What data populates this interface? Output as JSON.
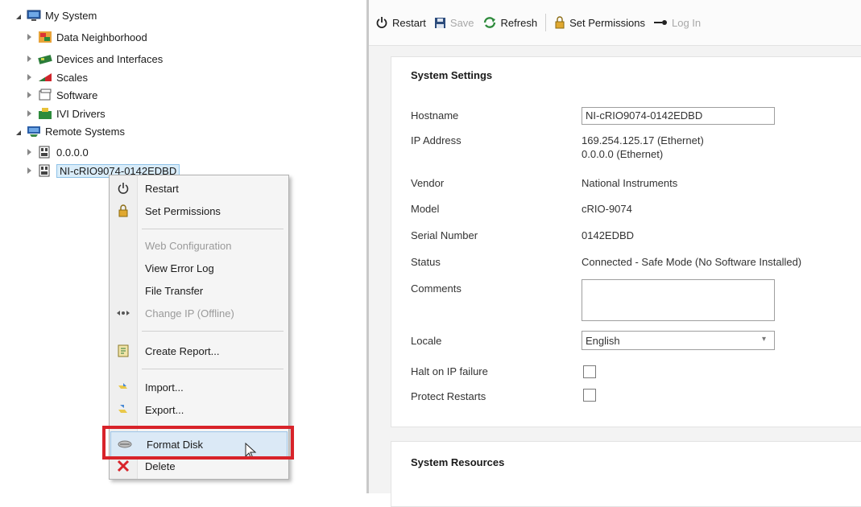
{
  "tree": {
    "my_system": "My System",
    "data_neighborhood": "Data Neighborhood",
    "devices": "Devices and Interfaces",
    "scales": "Scales",
    "software": "Software",
    "ivi": "IVI Drivers",
    "remote": "Remote Systems",
    "ip0": "0.0.0.0",
    "target": "NI-cRIO9074-0142EDBD"
  },
  "menu": {
    "restart": "Restart",
    "set_permissions": "Set Permissions",
    "web_config": "Web Configuration",
    "view_error_log": "View Error Log",
    "file_transfer": "File Transfer",
    "change_ip": "Change IP (Offline)",
    "create_report": "Create Report...",
    "import": "Import...",
    "export": "Export...",
    "format_disk": "Format Disk",
    "delete": "Delete"
  },
  "toolbar": {
    "restart": "Restart",
    "save": "Save",
    "refresh": "Refresh",
    "set_permissions": "Set Permissions",
    "login": "Log In"
  },
  "settings": {
    "title": "System Settings",
    "hostname_label": "Hostname",
    "hostname_value": "NI-cRIO9074-0142EDBD",
    "ip_label": "IP Address",
    "ip_value1": "169.254.125.17 (Ethernet)",
    "ip_value2": "0.0.0.0 (Ethernet)",
    "vendor_label": "Vendor",
    "vendor_value": "National Instruments",
    "model_label": "Model",
    "model_value": "cRIO-9074",
    "serial_label": "Serial Number",
    "serial_value": "0142EDBD",
    "status_label": "Status",
    "status_value": "Connected - Safe Mode (No Software Installed)",
    "comments_label": "Comments",
    "comments_value": "",
    "locale_label": "Locale",
    "locale_value": "English",
    "halt_label": "Halt on IP failure",
    "protect_label": "Protect Restarts"
  },
  "resources": {
    "title": "System Resources"
  },
  "colors": {
    "highlight_box": "#d8232a",
    "selection": "#d9ecf9"
  }
}
